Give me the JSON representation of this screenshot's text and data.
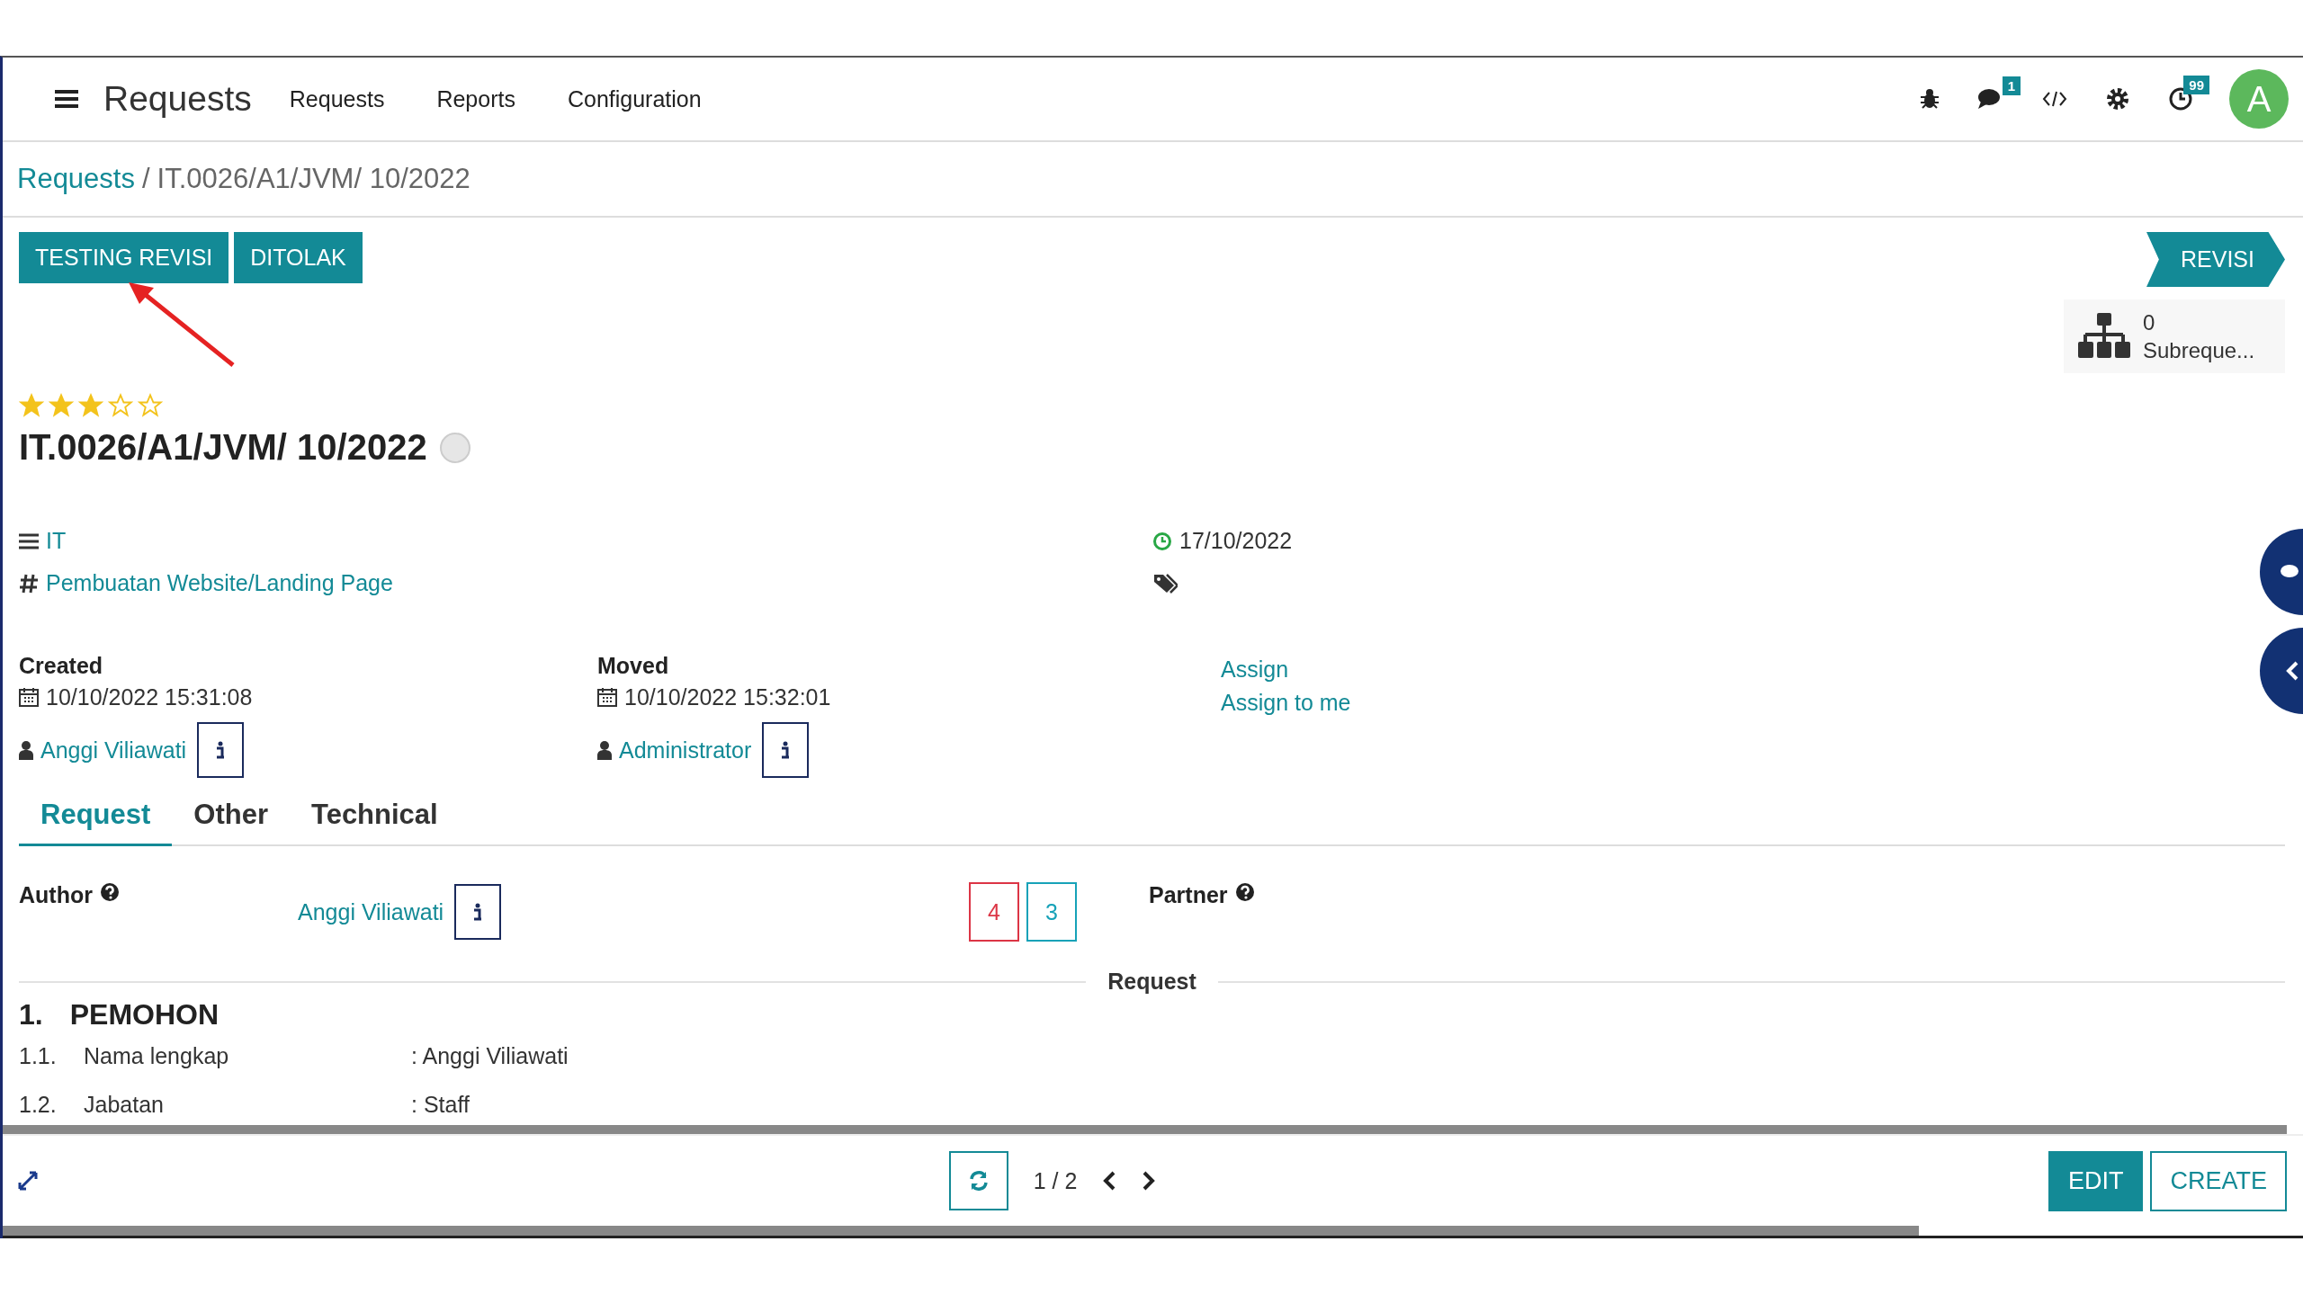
{
  "navbar": {
    "app_title": "Requests",
    "menu": [
      "Requests",
      "Reports",
      "Configuration"
    ],
    "chat_badge": "1",
    "activity_badge": "99",
    "avatar_letter": "A"
  },
  "breadcrumb": {
    "parent": "Requests",
    "separator": "/",
    "current": "IT.0026/A1/JVM/ 10/2022"
  },
  "action_buttons": [
    "TESTING REVISI",
    "DITOLAK"
  ],
  "stage": "REVISI",
  "subrequests": {
    "count": "0",
    "label": "Subreque..."
  },
  "record": {
    "stars": 3,
    "title": "IT.0026/A1/JVM/ 10/2022",
    "category": "IT",
    "type": "Pembuatan Website/Landing Page",
    "deadline": "17/10/2022"
  },
  "created": {
    "label": "Created",
    "date": "10/10/2022 15:31:08",
    "user": "Anggi Viliawati"
  },
  "moved": {
    "label": "Moved",
    "date": "10/10/2022 15:32:01",
    "user": "Administrator"
  },
  "assign_links": [
    "Assign",
    "Assign to me"
  ],
  "tabs": [
    {
      "label": "Request",
      "selected": true
    },
    {
      "label": "Other",
      "selected": false
    },
    {
      "label": "Technical",
      "selected": false
    }
  ],
  "author": {
    "label": "Author",
    "value": "Anggi Viliawati"
  },
  "counters": [
    {
      "value": "4",
      "color": "#dc3545"
    },
    {
      "value": "3",
      "color": "#17a2b8"
    }
  ],
  "partner": {
    "label": "Partner"
  },
  "section_title": "Request",
  "heading": {
    "number": "1.",
    "text": "PEMOHON"
  },
  "fields": [
    {
      "number": "1.1.",
      "label": "Nama lengkap",
      "value": ": Anggi Viliawati"
    },
    {
      "number": "1.2.",
      "label": "Jabatan",
      "value": ": Staff"
    }
  ],
  "pager": {
    "value": "1 / 2"
  },
  "footer_buttons": [
    {
      "label": "EDIT",
      "kind": "primary"
    },
    {
      "label": "CREATE",
      "kind": "secondary"
    }
  ]
}
